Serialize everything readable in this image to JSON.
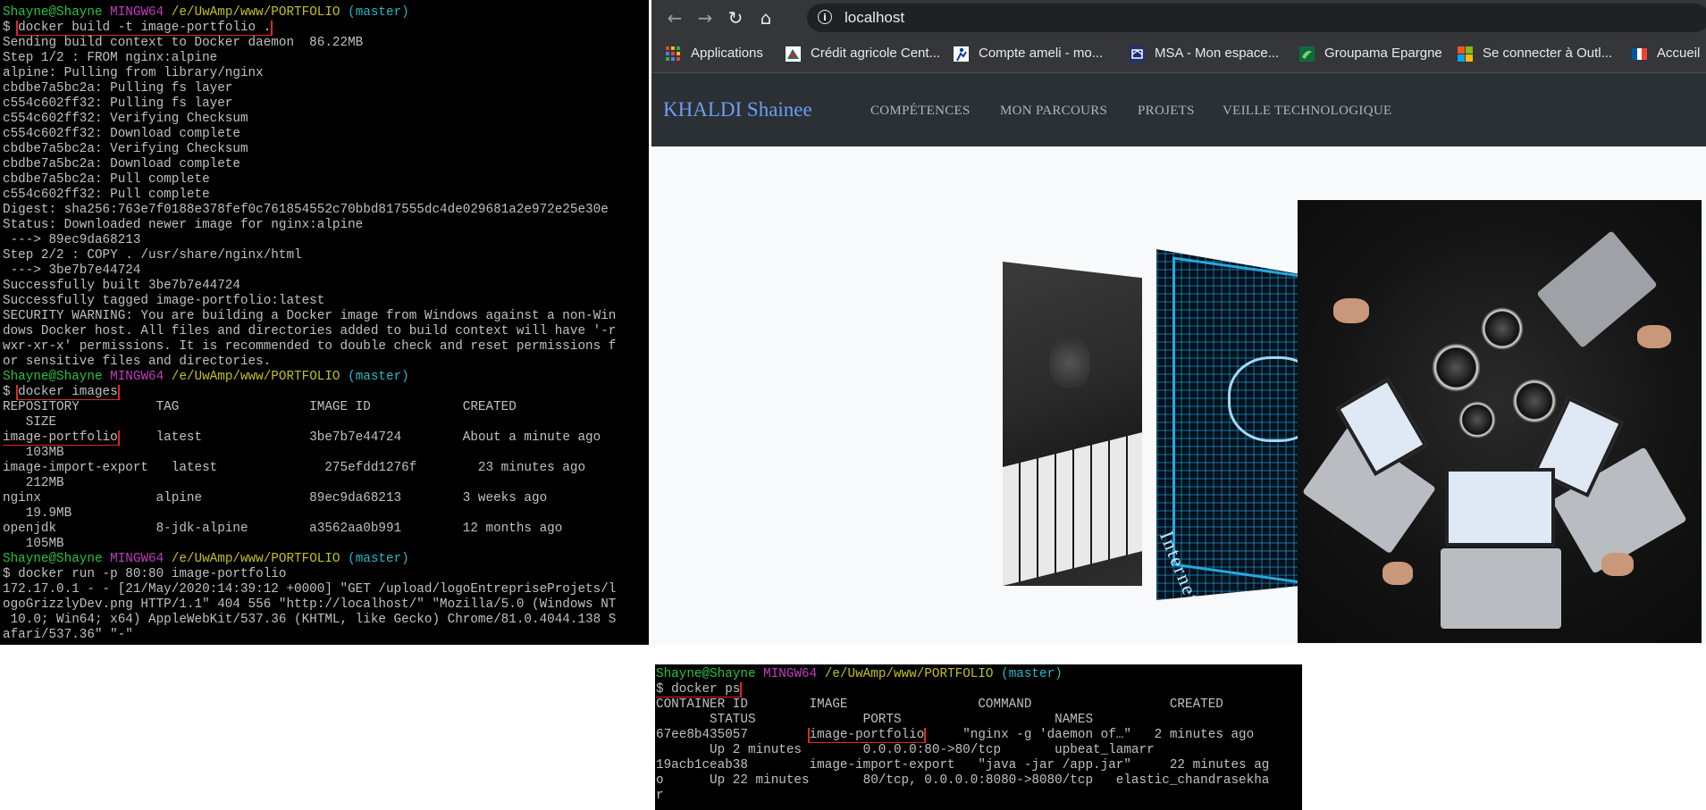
{
  "terminal_build": {
    "lines": [
      [
        {
          "t": "Shayne@Shayne ",
          "c": "g"
        },
        {
          "t": "MINGW64 ",
          "c": "m"
        },
        {
          "t": "/e/UwAmp/www/PORTFOLIO ",
          "c": "y"
        },
        {
          "t": "(master)",
          "c": "c"
        }
      ],
      [
        {
          "t": "$ "
        },
        {
          "t": "docker build -t image-portfolio .",
          "h": true
        }
      ],
      [
        {
          "t": "Sending build context to Docker daemon  86.22MB"
        }
      ],
      [
        {
          "t": "Step 1/2 : FROM nginx:alpine"
        }
      ],
      [
        {
          "t": "alpine: Pulling from library/nginx"
        }
      ],
      [
        {
          "t": "cbdbe7a5bc2a: Pulling fs layer"
        }
      ],
      [
        {
          "t": "c554c602ff32: Pulling fs layer"
        }
      ],
      [
        {
          "t": "c554c602ff32: Verifying Checksum"
        }
      ],
      [
        {
          "t": "c554c602ff32: Download complete"
        }
      ],
      [
        {
          "t": "cbdbe7a5bc2a: Verifying Checksum"
        }
      ],
      [
        {
          "t": "cbdbe7a5bc2a: Download complete"
        }
      ],
      [
        {
          "t": "cbdbe7a5bc2a: Pull complete"
        }
      ],
      [
        {
          "t": "c554c602ff32: Pull complete"
        }
      ],
      [
        {
          "t": "Digest: sha256:763e7f0188e378fef0c761854552c70bbd817555dc4de029681a2e972e25e30e"
        }
      ],
      [
        {
          "t": "Status: Downloaded newer image for nginx:alpine"
        }
      ],
      [
        {
          "t": " ---> 89ec9da68213"
        }
      ],
      [
        {
          "t": "Step 2/2 : COPY . /usr/share/nginx/html"
        }
      ],
      [
        {
          "t": " ---> 3be7b7e44724"
        }
      ],
      [
        {
          "t": "Successfully built 3be7b7e44724"
        }
      ],
      [
        {
          "t": "Successfully tagged image-portfolio:latest"
        }
      ],
      [
        {
          "t": "SECURITY WARNING: You are building a Docker image from Windows against a non-Win"
        }
      ],
      [
        {
          "t": "dows Docker host. All files and directories added to build context will have '-r"
        }
      ],
      [
        {
          "t": "wxr-xr-x' permissions. It is recommended to double check and reset permissions f"
        }
      ],
      [
        {
          "t": "or sensitive files and directories."
        }
      ],
      [
        {
          "t": "Shayne@Shayne ",
          "c": "g"
        },
        {
          "t": "MINGW64 ",
          "c": "m"
        },
        {
          "t": "/e/UwAmp/www/PORTFOLIO ",
          "c": "y"
        },
        {
          "t": "(master)",
          "c": "c"
        }
      ],
      [
        {
          "t": "$ "
        },
        {
          "t": "docker images",
          "h": true
        }
      ],
      [
        {
          "t": "REPOSITORY          TAG                 IMAGE ID            CREATED"
        }
      ],
      [
        {
          "t": "   SIZE"
        }
      ],
      [
        {
          "t": "image-portfolio",
          "h": true
        },
        {
          "t": "     latest              3be7b7e44724        About a minute ago"
        }
      ],
      [
        {
          "t": "   103MB"
        }
      ],
      [
        {
          "t": "image-import-export   latest              275efdd1276f        23 minutes ago"
        }
      ],
      [
        {
          "t": "   212MB"
        }
      ],
      [
        {
          "t": "nginx               alpine              89ec9da68213        3 weeks ago"
        }
      ],
      [
        {
          "t": "   19.9MB"
        }
      ],
      [
        {
          "t": "openjdk             8-jdk-alpine        a3562aa0b991        12 months ago"
        }
      ],
      [
        {
          "t": "   105MB"
        }
      ],
      [
        {
          "t": "Shayne@Shayne ",
          "c": "g"
        },
        {
          "t": "MINGW64 ",
          "c": "m"
        },
        {
          "t": "/e/UwAmp/www/PORTFOLIO ",
          "c": "y"
        },
        {
          "t": "(master)",
          "c": "c"
        }
      ],
      [
        {
          "t": "$ docker run -p 80:80 image-portfolio"
        }
      ],
      [
        {
          "t": "172.17.0.1 - - [21/May/2020:14:39:12 +0000] \"GET /upload/logoEntrepriseProjets/l"
        }
      ],
      [
        {
          "t": "ogoGrizzlyDev.png HTTP/1.1\" 404 556 \"http://localhost/\" \"Mozilla/5.0 (Windows NT"
        }
      ],
      [
        {
          "t": " 10.0; Win64; x64) AppleWebKit/537.36 (KHTML, like Gecko) Chrome/81.0.4044.138 S"
        }
      ],
      [
        {
          "t": "afari/537.36\" \"-\""
        }
      ]
    ]
  },
  "terminal_ps": {
    "lines": [
      [
        {
          "t": "Shayne@Shayne ",
          "c": "g"
        },
        {
          "t": "MINGW64 ",
          "c": "m"
        },
        {
          "t": "/e/UwAmp/www/PORTFOLIO ",
          "c": "y"
        },
        {
          "t": "(master)",
          "c": "c"
        }
      ],
      [
        {
          "t": "$ docker ps",
          "h": true
        }
      ],
      [
        {
          "t": "CONTAINER ID        IMAGE                 COMMAND                  CREATED"
        }
      ],
      [
        {
          "t": "       STATUS              PORTS                    NAMES"
        }
      ],
      [
        {
          "t": "67ee8b435057        "
        },
        {
          "t": "image-portfolio",
          "h": true
        },
        {
          "t": "     \"nginx -g 'daemon of…\"   2 minutes ago"
        }
      ],
      [
        {
          "t": "       Up 2 minutes        0.0.0.0:80->80/tcp       upbeat_lamarr"
        }
      ],
      [
        {
          "t": "19acb1ceab38        image-import-export   \"java -jar /app.jar\"     22 minutes ag"
        }
      ],
      [
        {
          "t": "o      Up 22 minutes       80/tcp, 0.0.0.0:8080->8080/tcp   elastic_chandrasekha"
        }
      ],
      [
        {
          "t": "r"
        }
      ]
    ]
  },
  "browser": {
    "url": "localhost",
    "bookmarks": [
      {
        "label": "Applications",
        "icon": "apps-grid-icon"
      },
      {
        "label": "Crédit agricole Cent...",
        "icon": "credit-agricole-icon"
      },
      {
        "label": "Compte ameli - mo...",
        "icon": "ameli-icon"
      },
      {
        "label": "MSA - Mon espace...",
        "icon": "msa-icon"
      },
      {
        "label": "Groupama Epargne",
        "icon": "groupama-icon"
      },
      {
        "label": "Se connecter à Outl...",
        "icon": "microsoft-icon"
      },
      {
        "label": "Accueil",
        "icon": "gouv-flag-icon"
      }
    ]
  },
  "site": {
    "brand": "KHALDI Shainee",
    "nav": [
      "COMPÉTENCES",
      "MON PARCOURS",
      "PROJETS",
      "VEILLE TECHNOLOGIQUE"
    ],
    "carousel_word": "Internet"
  },
  "colors": {
    "highlight": "#e0262c",
    "prompt_user": "#26c241",
    "prompt_mingw": "#c53ac5",
    "prompt_path": "#c2bf22",
    "prompt_branch": "#2ab7c5",
    "brand": "#6d9ff0"
  }
}
